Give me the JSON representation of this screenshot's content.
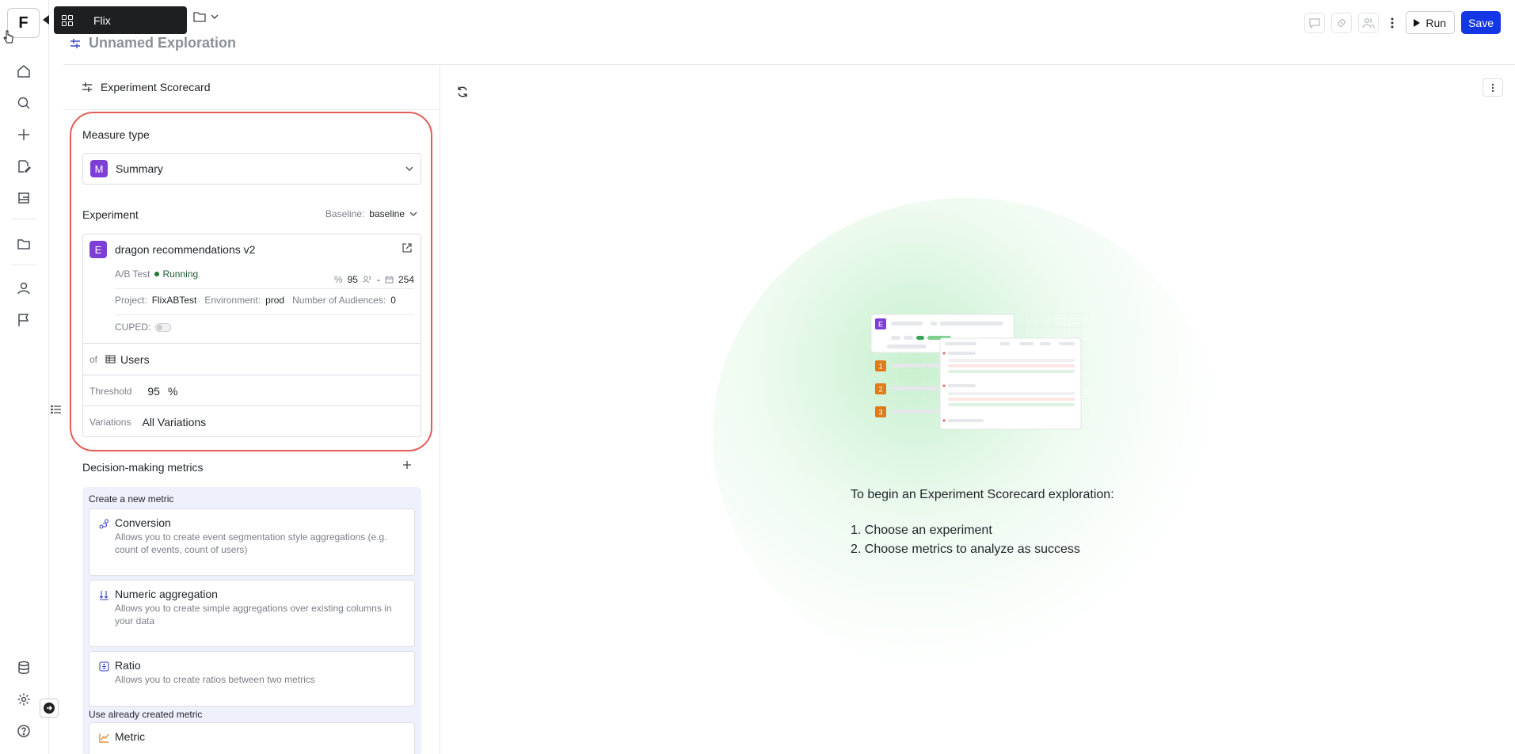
{
  "app": {
    "logo_letter": "F",
    "tooltip": "Flix",
    "title": "Unnamed Exploration"
  },
  "header": {
    "run_label": "Run",
    "save_label": "Save"
  },
  "panel": {
    "heading": "Experiment Scorecard",
    "measure_type_label": "Measure type",
    "measure_type": {
      "badge": "M",
      "value": "Summary"
    },
    "experiment_label": "Experiment",
    "baseline_label": "Baseline:",
    "baseline_value": "baseline",
    "experiment": {
      "badge": "E",
      "name": "dragon recommendations v2",
      "type": "A/B Test",
      "status": "Running",
      "confidence": "95",
      "audience": "-",
      "days": "254",
      "project_label": "Project:",
      "project": "FlixABTest",
      "environment_label": "Environment:",
      "environment": "prod",
      "audiences_label": "Number of Audiences:",
      "audiences": "0",
      "cuped_label": "CUPED:"
    },
    "of_label": "of",
    "of_value": "Users",
    "threshold_label": "Threshold",
    "threshold_value": "95",
    "threshold_unit": "%",
    "variations_label": "Variations",
    "variations_value": "All Variations",
    "decision_metrics_label": "Decision-making metrics",
    "create_new_label": "Create a new metric",
    "metric_types": [
      {
        "name": "Conversion",
        "desc": "Allows you to create event segmentation style aggregations (e.g. count of events, count of users)"
      },
      {
        "name": "Numeric aggregation",
        "desc": "Allows you to create simple aggregations over existing columns in your data"
      },
      {
        "name": "Ratio",
        "desc": "Allows you to create ratios between two metrics"
      }
    ],
    "use_existing_label": "Use already created metric",
    "existing_metric": "Metric"
  },
  "empty_state": {
    "title": "To begin an Experiment Scorecard exploration:",
    "steps": [
      "1. Choose an experiment",
      "2. Choose metrics to analyze as success"
    ]
  },
  "illustration": {
    "badge": "E",
    "rows": [
      "1",
      "2",
      "3"
    ]
  },
  "colors": {
    "accent": "#1437e6",
    "badge_purple": "#7e3fd6",
    "highlight_outline": "#e25d57",
    "running_green": "#1e7a36",
    "row_orange": "#e07b1a"
  }
}
